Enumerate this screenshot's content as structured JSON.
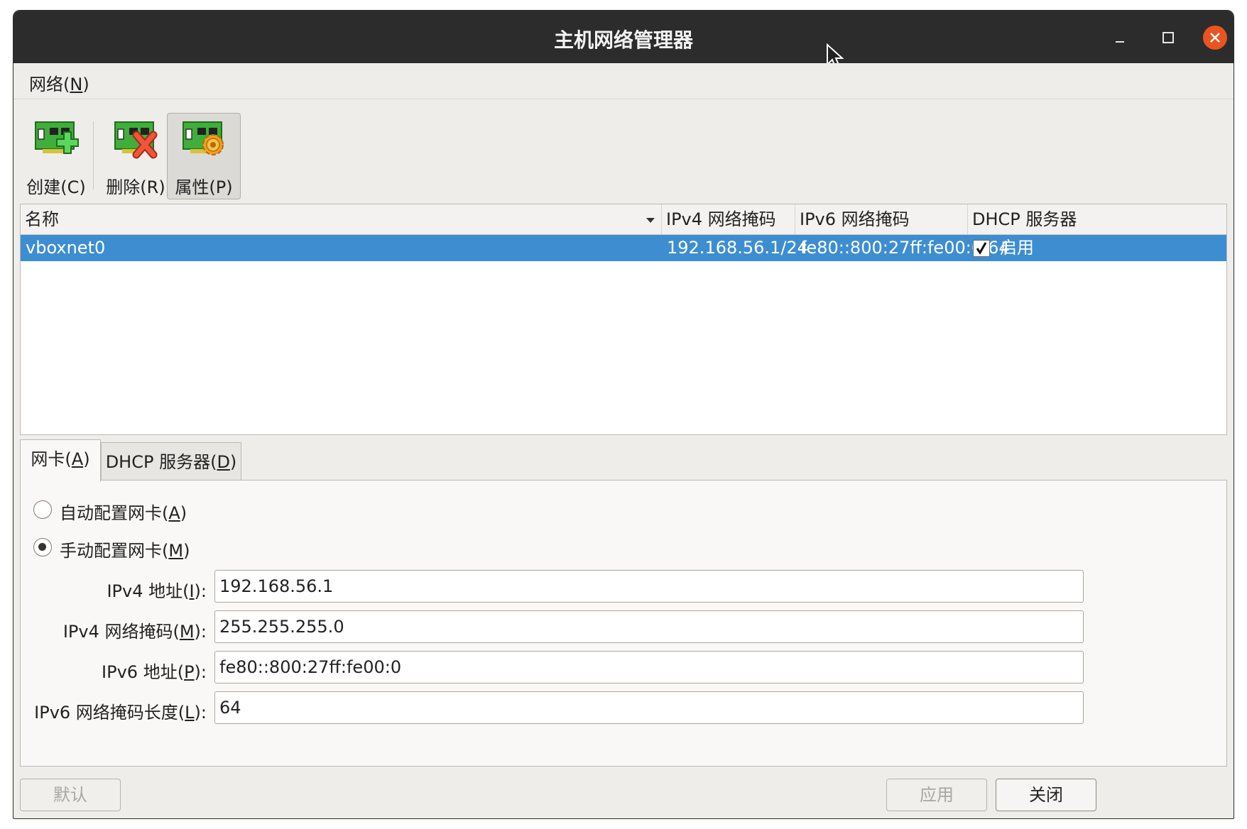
{
  "window": {
    "title": "主机网络管理器"
  },
  "menu": {
    "network_prefix": "网络(",
    "network_key": "N",
    "network_suffix": ")"
  },
  "toolbar": {
    "create": "创建(C)",
    "remove": "删除(R)",
    "properties": "属性(P)"
  },
  "table": {
    "columns": [
      "名称",
      "IPv4 网络掩码",
      "IPv6 网络掩码",
      "DHCP 服务器"
    ],
    "rows": [
      {
        "name": "vboxnet0",
        "ipv4": "192.168.56.1/24",
        "ipv6": "fe80::800:27ff:fe00:0/64",
        "dhcp": "启用",
        "dhcp_checked": true
      }
    ]
  },
  "tabs": {
    "adapter": {
      "prefix": "网卡(",
      "key": "A",
      "suffix": ")"
    },
    "dhcp": {
      "prefix": "DHCP 服务器(",
      "key": "D",
      "suffix": ")"
    }
  },
  "adapter": {
    "auto": {
      "prefix": "自动配置网卡(",
      "key": "A",
      "suffix": ")",
      "selected": false
    },
    "manual": {
      "prefix": "手动配置网卡(",
      "key": "M",
      "suffix": ")",
      "selected": true
    },
    "fields": {
      "ipv4_addr": {
        "prefix": "IPv4 地址(",
        "key": "I",
        "suffix": "):",
        "value": "192.168.56.1"
      },
      "ipv4_mask": {
        "prefix": "IPv4 网络掩码(",
        "key": "M",
        "suffix": "):",
        "value": "255.255.255.0"
      },
      "ipv6_addr": {
        "prefix": "IPv6 地址(",
        "key": "P",
        "suffix": "):",
        "value": "fe80::800:27ff:fe00:0"
      },
      "ipv6_len": {
        "prefix": "IPv6 网络掩码长度(",
        "key": "L",
        "suffix": "):",
        "value": "64"
      }
    }
  },
  "buttons": {
    "reset": "默认",
    "apply": "应用",
    "close": "关闭"
  },
  "colors": {
    "selection": "#3d8ed1",
    "titlebar": "#2c2c2c",
    "close_button": "#e95420"
  }
}
